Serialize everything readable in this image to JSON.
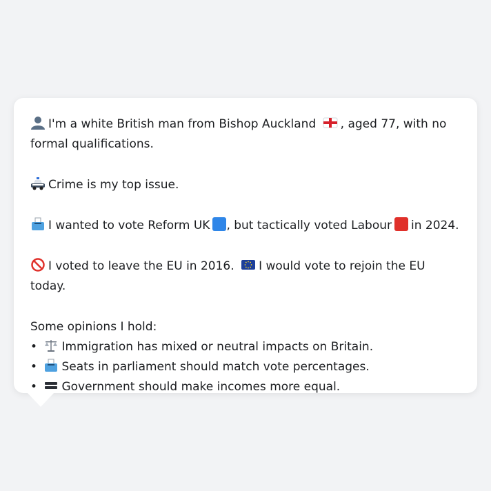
{
  "profile": {
    "intro_text_1": "I'm a white British man from Bishop Auckland",
    "intro_text_2": ", aged 77, with no formal qualifications.",
    "crime_text": "Crime is my top issue.",
    "vote_text_1": "I wanted to vote Reform UK",
    "vote_text_2": ", but tactically voted Labour",
    "vote_text_3": "in 2024.",
    "eu_text_1": "I voted to leave the EU in 2016.",
    "eu_text_2": "I would vote to rejoin the EU today.",
    "opinions_heading": "Some opinions I hold:",
    "bullet_char": "•",
    "opinions": [
      "Immigration has mixed or neutral impacts on Britain.",
      "Seats in parliament should match vote percentages.",
      "Government should make incomes more equal."
    ]
  },
  "icons": {
    "person": "person-silhouette-icon",
    "flag": "england-flag-icon",
    "police_car": "police-car-icon",
    "ballot": "ballot-box-icon",
    "no_entry": "prohibited-icon",
    "eu_flag": "eu-flag-icon",
    "scales": "balance-scale-icon",
    "equals": "equals-icon"
  },
  "colors": {
    "reform_blue": "#2f86e8",
    "labour_red": "#e0302a",
    "text": "#1c1e21",
    "background": "#f2f3f5",
    "bubble": "#ffffff"
  }
}
